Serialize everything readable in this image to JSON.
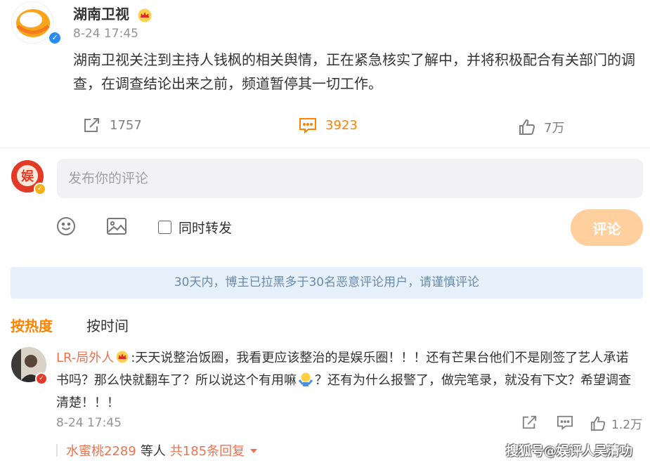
{
  "post": {
    "author": "湖南卫视",
    "time": "8-24 17:45",
    "body": "湖南卫视关注到主持人钱枫的相关舆情，正在紧急核实了解中，并将积极配合有关部门的调查，在调查结论出来之前，频道暂停其一切工作。",
    "share_count": "1757",
    "comment_count": "3923",
    "like_count": "7万"
  },
  "composer": {
    "placeholder": "发布你的评论",
    "repost_label": "同时转发",
    "submit_label": "评论"
  },
  "notice": "30天内，博主已拉黑多于30名恶意评论用户，请谨慎评论",
  "sort": {
    "hot": "按热度",
    "time": "按时间"
  },
  "comment": {
    "user": "LR-局外人",
    "text_part1": ":天天说整治饭圈，我看更应该整治的是娱乐圈！！！还有芒果台他们不是刚签了艺人承诺书吗？那么快就翻车了？所以说这个有用嘛",
    "text_part2": "？还有为什么报警了，做完笔录，就没有下文？希望调查清楚！！！",
    "time": "8-24 17:45",
    "like_count": "1.2万",
    "replies_user": "水蜜桃2289",
    "replies_word": "等人",
    "replies_count": "共185条回复"
  },
  "watermark": "搜狐号@娱评人吴清功",
  "colors": {
    "accent": "#ff8200",
    "username": "#eb7350",
    "submit_disabled": "#ffcf9e",
    "notice_bg": "#e6f0fa",
    "verified_blue": "#2a8bf2"
  },
  "icons": {
    "share": "share-icon",
    "comment": "comment-icon",
    "like": "thumbs-up-icon",
    "emoji": "emoji-icon",
    "image": "image-icon"
  }
}
